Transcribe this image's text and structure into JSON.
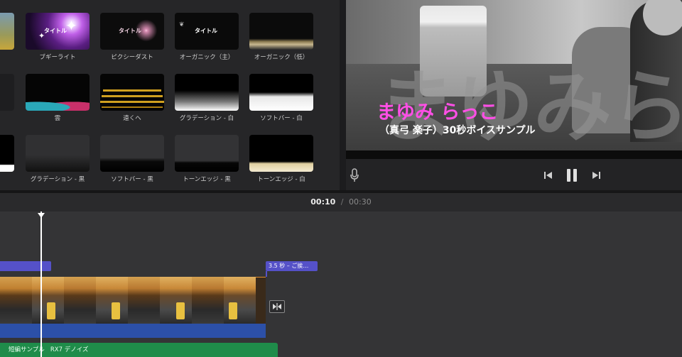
{
  "title_browser": {
    "tiles": [
      {
        "label": "",
        "preview_text": ""
      },
      {
        "label": "ブギーライト",
        "preview_text": "タイトル"
      },
      {
        "label": "ピクシーダスト",
        "preview_text": "タイトル"
      },
      {
        "label": "オーガニック（主）",
        "preview_text": "タイトル"
      },
      {
        "label": "オーガニック（低）",
        "preview_text": ""
      },
      {
        "label": "",
        "preview_text": ""
      },
      {
        "label": "雲",
        "preview_text": ""
      },
      {
        "label": "遠くへ",
        "preview_text": ""
      },
      {
        "label": "グラデーション - 白",
        "preview_text": ""
      },
      {
        "label": "ソフトバー - 白",
        "preview_text": ""
      },
      {
        "label": "",
        "preview_text": ""
      },
      {
        "label": "グラデーション - 黒",
        "preview_text": ""
      },
      {
        "label": "ソフトバー - 黒",
        "preview_text": ""
      },
      {
        "label": "トーンエッジ - 黒",
        "preview_text": ""
      },
      {
        "label": "トーンエッジ - 白",
        "preview_text": ""
      }
    ]
  },
  "viewer": {
    "title_line1": "まゆみ らっこ",
    "title_line2": "（真弓 楽子）30秒ボイスサンプル",
    "background_text": "まゆみら",
    "title_color": "#ff4fe6"
  },
  "playback": {
    "current_time": "00:10",
    "separator": "/",
    "total_time": "00:30"
  },
  "timeline": {
    "title_clip_label": "3.5 秒 – ご挨…",
    "audio_track_label": "短編サンプル   RX7 デノイズ",
    "title_clip_color": "#5551c8",
    "video_track_color": "#2c50a8",
    "audio_track_color": "#1f8c4a"
  }
}
